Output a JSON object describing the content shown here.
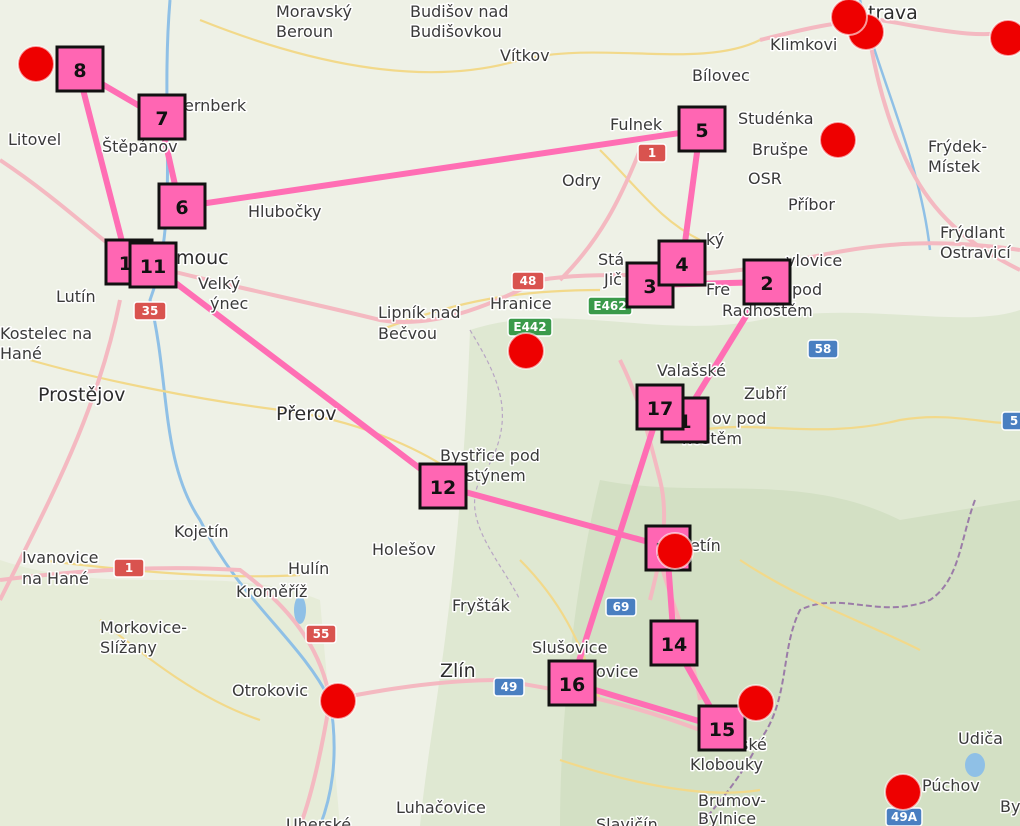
{
  "colors": {
    "route": "#ff6eb4",
    "waypoint_fill": "#ff66b3",
    "marker": "#ee0000",
    "road_major": "#f4b9c1",
    "road_minor": "#f2d98a",
    "shield_red": "#d9534f",
    "shield_blue": "#4a7fc1",
    "shield_green": "#3a9a4a"
  },
  "places": [
    {
      "name": "Moravský",
      "style": "normal"
    },
    {
      "name": "Beroun",
      "style": "normal"
    },
    {
      "name": "Budišov nad",
      "style": "normal"
    },
    {
      "name": "Budišovkou",
      "style": "normal"
    },
    {
      "name": "Vítkov",
      "style": "normal"
    },
    {
      "name": "Bílovec",
      "style": "normal"
    },
    {
      "name": "Klimkovi",
      "style": "normal"
    },
    {
      "name": "trava",
      "style": "big"
    },
    {
      "name": "Litovel",
      "style": "normal"
    },
    {
      "name": "Štěpánov",
      "style": "normal"
    },
    {
      "name": "ernberk",
      "style": "normal"
    },
    {
      "name": "Fulnek",
      "style": "normal"
    },
    {
      "name": "Studénka",
      "style": "normal"
    },
    {
      "name": "Brušpe",
      "style": "normal"
    },
    {
      "name": "Frýdek-",
      "style": "normal"
    },
    {
      "name": "Místek",
      "style": "normal"
    },
    {
      "name": "Odry",
      "style": "normal"
    },
    {
      "name": "OSR",
      "style": "normal"
    },
    {
      "name": "Příbor",
      "style": "normal"
    },
    {
      "name": "Hlubočky",
      "style": "normal"
    },
    {
      "name": "mouc",
      "style": "big"
    },
    {
      "name": "Frýdlant",
      "style": "normal"
    },
    {
      "name": "Ostravicí",
      "style": "normal"
    },
    {
      "name": "Lutín",
      "style": "normal"
    },
    {
      "name": "Velký",
      "style": "normal"
    },
    {
      "name": "ýnec",
      "style": "normal"
    },
    {
      "name": "Lipník nad",
      "style": "normal"
    },
    {
      "name": "Bečvou",
      "style": "normal"
    },
    {
      "name": "Hranice",
      "style": "normal"
    },
    {
      "name": "Kostelec na",
      "style": "normal"
    },
    {
      "name": "Hané",
      "style": "normal"
    },
    {
      "name": "Prostějov",
      "style": "big"
    },
    {
      "name": "Přerov",
      "style": "big"
    },
    {
      "name": "Valašské",
      "style": "normal"
    },
    {
      "name": "Zubří",
      "style": "normal"
    },
    {
      "name": "ov pod",
      "style": "normal"
    },
    {
      "name": "hoštěm",
      "style": "normal"
    },
    {
      "name": "Bystřice pod",
      "style": "normal"
    },
    {
      "name": "stýnem",
      "style": "normal"
    },
    {
      "name": "Kojetín",
      "style": "normal"
    },
    {
      "name": "Holešov",
      "style": "normal"
    },
    {
      "name": "etín",
      "style": "normal"
    },
    {
      "name": "Ivanovice",
      "style": "normal"
    },
    {
      "name": "na Hané",
      "style": "normal"
    },
    {
      "name": "Hulín",
      "style": "normal"
    },
    {
      "name": "Kroměříž",
      "style": "normal"
    },
    {
      "name": "Fryšták",
      "style": "normal"
    },
    {
      "name": "Morkovice-",
      "style": "normal"
    },
    {
      "name": "Slížany",
      "style": "normal"
    },
    {
      "name": "Slušovice",
      "style": "normal"
    },
    {
      "name": "Otrokovic",
      "style": "normal"
    },
    {
      "name": "Zlín",
      "style": "big"
    },
    {
      "name": "ovice",
      "style": "normal"
    },
    {
      "name": "Klobouky",
      "style": "normal"
    },
    {
      "name": "Brumov-",
      "style": "normal"
    },
    {
      "name": "Bylnice",
      "style": "normal"
    },
    {
      "name": "Luhačovice",
      "style": "normal"
    },
    {
      "name": "Uherské",
      "style": "normal"
    },
    {
      "name": "Udiča",
      "style": "normal"
    },
    {
      "name": "Púchov",
      "style": "normal"
    },
    {
      "name": "Stá",
      "style": "normal"
    },
    {
      "name": "Jič",
      "style": "normal"
    },
    {
      "name": "Fre",
      "style": "normal"
    },
    {
      "name": "pod",
      "style": "normal"
    },
    {
      "name": "Radhoštěm",
      "style": "normal"
    },
    {
      "name": "vlovice",
      "style": "normal"
    },
    {
      "name": "ký",
      "style": "normal"
    },
    {
      "name": "ské",
      "style": "normal"
    },
    {
      "name": "By",
      "style": "normal"
    },
    {
      "name": "Slavičín",
      "style": "normal"
    }
  ],
  "road_shields": [
    {
      "label": "1",
      "type": "red"
    },
    {
      "label": "48",
      "type": "red"
    },
    {
      "label": "E462",
      "type": "green"
    },
    {
      "label": "E442",
      "type": "green"
    },
    {
      "label": "35",
      "type": "red"
    },
    {
      "label": "58",
      "type": "blue"
    },
    {
      "label": "1",
      "type": "red"
    },
    {
      "label": "55",
      "type": "red"
    },
    {
      "label": "69",
      "type": "blue"
    },
    {
      "label": "49",
      "type": "blue"
    },
    {
      "label": "49A",
      "type": "blue"
    },
    {
      "label": "5",
      "type": "blue"
    }
  ],
  "waypoints": [
    "8",
    "7",
    "6",
    "5",
    "4",
    "3",
    "2",
    "1",
    "17",
    "10",
    "11",
    "12",
    "13",
    "14",
    "15",
    "16"
  ],
  "route_order": [
    "8",
    "7",
    "6",
    "5",
    "4",
    "3",
    "2",
    "1",
    "17",
    "16",
    "15",
    "14",
    "13",
    "12",
    "11",
    "10",
    "8"
  ],
  "markers": [
    "m1",
    "m2",
    "m3",
    "m4",
    "m5",
    "m6",
    "m7",
    "m8",
    "m9",
    "m10",
    "m11",
    "m12"
  ]
}
